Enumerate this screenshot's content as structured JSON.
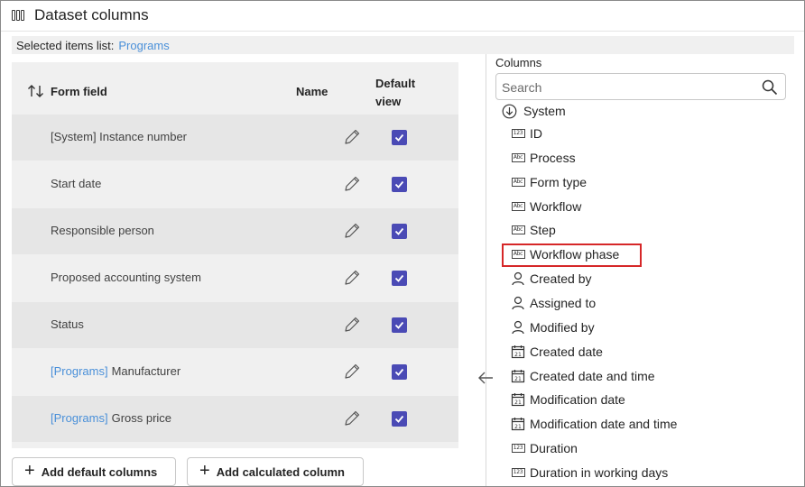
{
  "window": {
    "title": "Dataset columns",
    "title_icon": "columns-icon"
  },
  "selected_list": {
    "label": "Selected items list:",
    "value": "Programs"
  },
  "table": {
    "headers": {
      "form_field": "Form field",
      "name": "Name",
      "default_view_line1": "Default",
      "default_view_line2": "view"
    },
    "rows": [
      {
        "prefix": "",
        "label": "[System] Instance number",
        "checked": true
      },
      {
        "prefix": "",
        "label": "Start date",
        "checked": true
      },
      {
        "prefix": "",
        "label": "Responsible person",
        "checked": true
      },
      {
        "prefix": "",
        "label": "Proposed accounting system",
        "checked": true
      },
      {
        "prefix": "",
        "label": "Status",
        "checked": true
      },
      {
        "prefix": "[Programs]",
        "label": "Manufacturer",
        "checked": true
      },
      {
        "prefix": "[Programs]",
        "label": "Gross price",
        "checked": true
      }
    ]
  },
  "buttons": {
    "add_default": "Add default columns",
    "add_calculated": "Add calculated column"
  },
  "columns_panel": {
    "header": "Columns",
    "search_placeholder": "Search",
    "group": "System",
    "items": [
      {
        "label": "ID",
        "icon": "number-icon"
      },
      {
        "label": "Process",
        "icon": "text-icon"
      },
      {
        "label": "Form type",
        "icon": "text-icon"
      },
      {
        "label": "Workflow",
        "icon": "text-icon"
      },
      {
        "label": "Step",
        "icon": "text-icon"
      },
      {
        "label": "Workflow phase",
        "icon": "text-icon",
        "highlighted": true
      },
      {
        "label": "Created by",
        "icon": "person-icon"
      },
      {
        "label": "Assigned to",
        "icon": "person-icon"
      },
      {
        "label": "Modified by",
        "icon": "person-icon"
      },
      {
        "label": "Created date",
        "icon": "calendar-icon"
      },
      {
        "label": "Created date and time",
        "icon": "calendar-icon"
      },
      {
        "label": "Modification date",
        "icon": "calendar-icon"
      },
      {
        "label": "Modification date and time",
        "icon": "calendar-icon"
      },
      {
        "label": "Duration",
        "icon": "number-icon"
      },
      {
        "label": "Duration in working days",
        "icon": "number-icon"
      }
    ]
  },
  "colors": {
    "accent": "#4a4ab5",
    "link": "#4a90d9",
    "highlight_border": "#d62728",
    "row_alt": "#e6e6e6"
  }
}
